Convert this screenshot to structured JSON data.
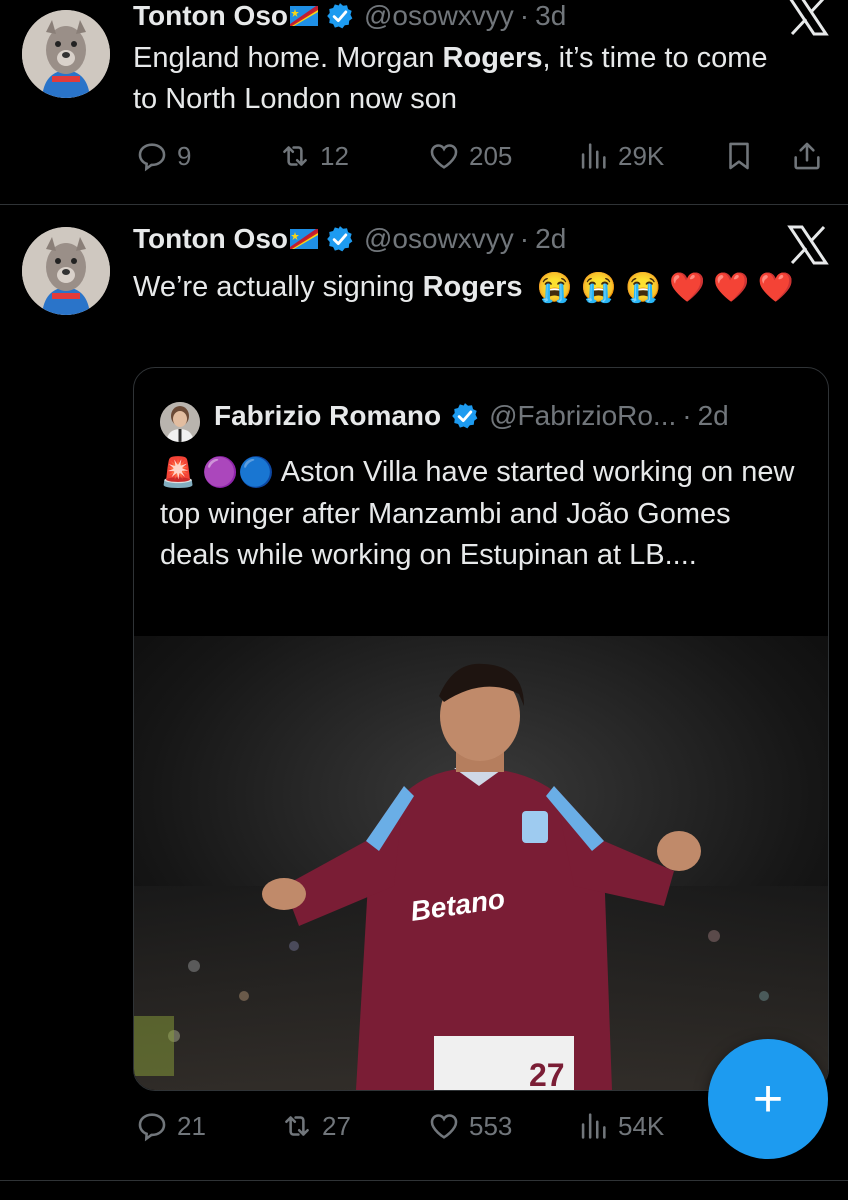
{
  "tweets": [
    {
      "author_name": "Tonton Oso",
      "handle": "@osowxvyy",
      "separator": "·",
      "time": "3d",
      "text_parts": [
        "England home. Morgan ",
        "Rogers",
        ", it’s time to come to North London now son"
      ],
      "stats": {
        "replies": "9",
        "reposts": "12",
        "likes": "205",
        "views": "29K"
      }
    },
    {
      "author_name": "Tonton Oso",
      "handle": "@osowxvyy",
      "separator": "·",
      "time": "2d",
      "text_parts": [
        "We’re actually signing ",
        "Rogers"
      ],
      "emojis": [
        "😭",
        "😭",
        "😭",
        "❤️",
        "❤️",
        "❤️"
      ],
      "stats": {
        "replies": "21",
        "reposts": "27",
        "likes": "553",
        "views": "54K"
      }
    }
  ],
  "quote": {
    "author_name": "Fabrizio Romano",
    "handle": "@FabrizioRo...",
    "separator": "·",
    "time": "2d",
    "emojis": [
      "🚨",
      "🟣",
      "🔵"
    ],
    "text": "Aston Villa have started working on new top winger after Manzambi and João Gomes deals while working on Estupinan at LB....",
    "photo": {
      "shirt_sponsor": "Betano",
      "shirt_number": "27"
    }
  },
  "fab": {
    "icon": "plus-icon",
    "label": "+"
  },
  "colors": {
    "background": "#000000",
    "text": "#e7e9ea",
    "muted": "#71767b",
    "accent": "#1d9bf0",
    "verified": "#1d9bf0",
    "heart": "#e0245e"
  }
}
